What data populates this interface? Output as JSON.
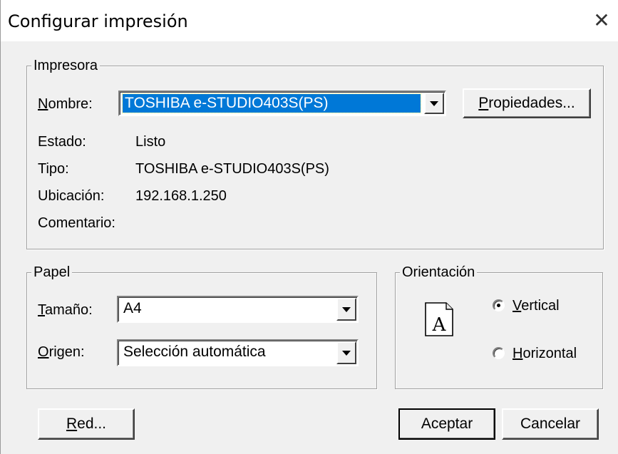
{
  "window": {
    "title": "Configurar impresión",
    "close_icon": "close-icon"
  },
  "printer_group": {
    "legend": "Impresora",
    "name_label_accel": "N",
    "name_label_rest": "ombre:",
    "name_value": "TOSHIBA e-STUDIO403S(PS)",
    "properties_accel": "P",
    "properties_rest": "ropiedades...",
    "status_label": "Estado:",
    "status_value": "Listo",
    "type_label": "Tipo:",
    "type_value": "TOSHIBA e-STUDIO403S(PS)",
    "location_label": "Ubicación:",
    "location_value": "192.168.1.250",
    "comment_label": "Comentario:",
    "comment_value": ""
  },
  "paper_group": {
    "legend": "Papel",
    "size_label_accel": "T",
    "size_label_rest": "amaño:",
    "size_value": "A4",
    "source_label_accel": "O",
    "source_label_rest": "rigen:",
    "source_value": "Selección automática"
  },
  "orientation_group": {
    "legend": "Orientación",
    "page_icon_letter": "A",
    "vertical_accel": "V",
    "vertical_rest": "ertical",
    "horizontal_accel": "H",
    "horizontal_rest": "orizontal",
    "selected": "vertical"
  },
  "buttons": {
    "network_accel": "R",
    "network_rest": "ed...",
    "ok": "Aceptar",
    "cancel": "Cancelar"
  },
  "colors": {
    "selection": "#0078d7",
    "dialog_bg": "#f0f0f0"
  }
}
